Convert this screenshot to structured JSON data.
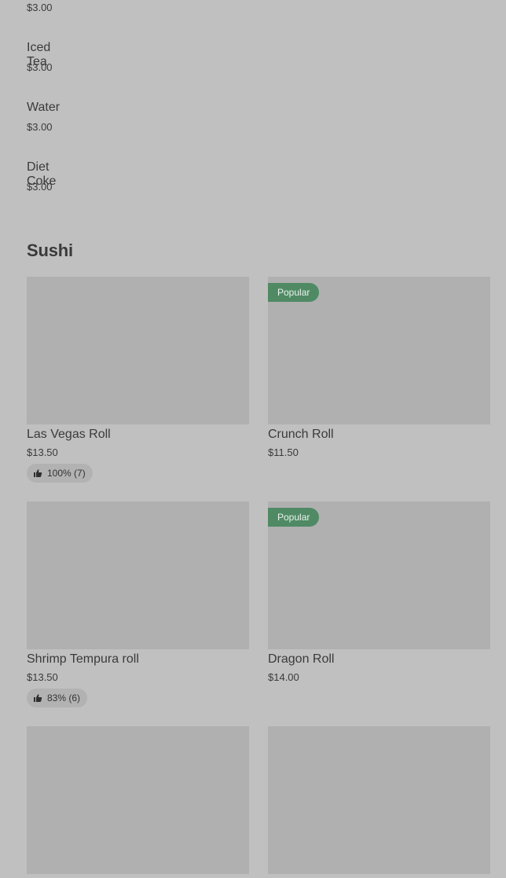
{
  "drinks": [
    {
      "name": "",
      "price": "$3.00"
    },
    {
      "name": "Iced Tea",
      "price": "$3.00"
    },
    {
      "name": "Water",
      "price": "$3.00"
    },
    {
      "name": "Diet Coke",
      "price": "$3.00"
    }
  ],
  "sushi": {
    "title": "Sushi",
    "items": [
      {
        "name": "Las Vegas Roll",
        "price": "$13.50",
        "badge": "",
        "rating": "100% (7)"
      },
      {
        "name": "Crunch Roll",
        "price": "$11.50",
        "badge": "Popular",
        "rating": ""
      },
      {
        "name": "Shrimp Tempura roll",
        "price": "$13.50",
        "badge": "",
        "rating": "83% (6)"
      },
      {
        "name": "Dragon Roll",
        "price": "$14.00",
        "badge": "Popular",
        "rating": ""
      },
      {
        "name": "",
        "price": "",
        "badge": "",
        "rating": ""
      },
      {
        "name": "",
        "price": "",
        "badge": "",
        "rating": ""
      }
    ]
  },
  "colors": {
    "background": "#c0c0c0",
    "image_placeholder": "#b0b0b0",
    "popular_badge": "#4f8a65",
    "rating_pill": "#b2b2b2"
  },
  "icons": {
    "rating": "thumbs-up-icon"
  }
}
